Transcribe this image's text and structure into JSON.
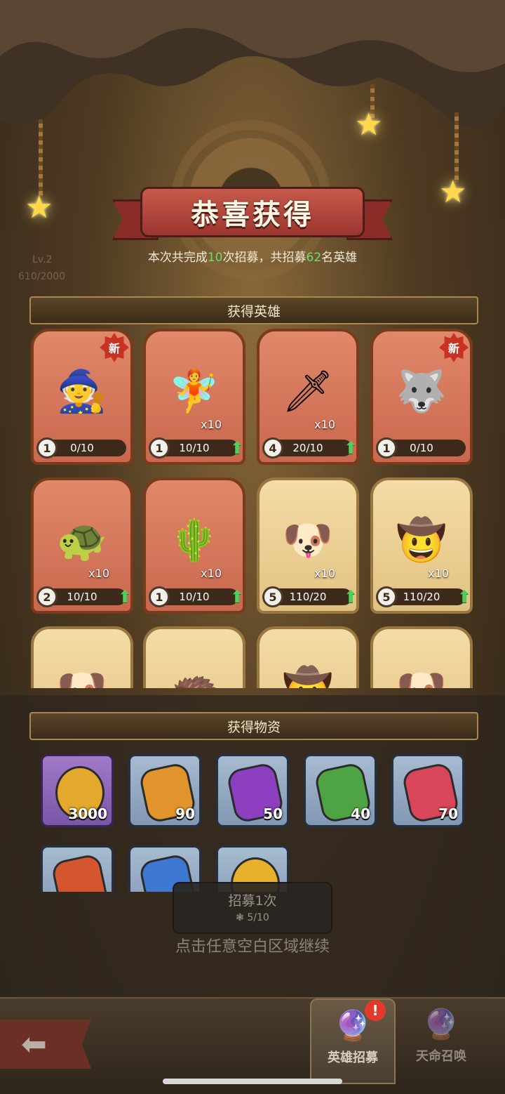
{
  "header": {
    "title": "恭喜获得",
    "summary_prefix": "本次共完成",
    "recruit_times": "10",
    "summary_middle": "次招募，共招募",
    "hero_count": "62",
    "summary_suffix": "名英雄"
  },
  "background": {
    "level": "Lv.2",
    "exp": "610/2000"
  },
  "sections": {
    "heroes_title": "获得英雄",
    "items_title": "获得物资"
  },
  "heroes": [
    {
      "level": "1",
      "progress": "0/10",
      "badge": "新"
    },
    {
      "level": "1",
      "progress": "10/10",
      "shards": "x10"
    },
    {
      "level": "4",
      "progress": "20/10",
      "shards": "x10"
    },
    {
      "level": "1",
      "progress": "0/10",
      "badge": "新"
    },
    {
      "level": "2",
      "progress": "10/10",
      "shards": "x10"
    },
    {
      "level": "1",
      "progress": "10/10",
      "shards": "x10"
    },
    {
      "level": "5",
      "progress": "110/20",
      "shards": "x10"
    },
    {
      "level": "5",
      "progress": "110/20",
      "shards": "x10"
    }
  ],
  "items": [
    {
      "icon": "gold-coin-icon",
      "qty": "3000"
    },
    {
      "icon": "orange-rune-icon",
      "qty": "90"
    },
    {
      "icon": "purple-rune-icon",
      "qty": "50"
    },
    {
      "icon": "green-rune-icon",
      "qty": "40"
    },
    {
      "icon": "red-rune-icon",
      "qty": "70"
    },
    {
      "icon": "red-orange-rune-icon"
    },
    {
      "icon": "blue-rune-icon"
    },
    {
      "icon": "gold-token-icon"
    }
  ],
  "recruit_button": {
    "label": "招募1次",
    "cost": "5/10"
  },
  "hint": "点击任意空白区域继续",
  "nav": {
    "tabs": [
      "英雄招募",
      "天命召唤"
    ]
  },
  "colors": {
    "highlight_green": "#69e06a",
    "ribbon_red": "#c65a4a",
    "card_red": "#e0886a",
    "card_gold": "#f3dca6"
  }
}
